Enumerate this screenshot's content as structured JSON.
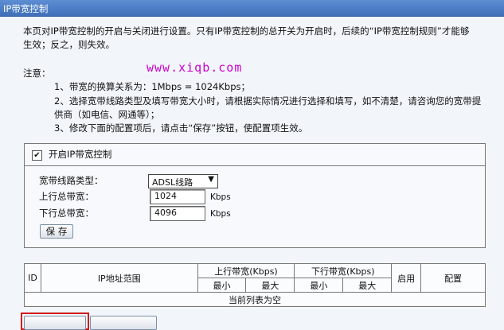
{
  "window": {
    "title": "IP带宽控制"
  },
  "intro": {
    "line1": "本页对IP带宽控制的开启与关闭进行设置。只有IP带宽控制的总开关为开启时，后续的“IP带宽控制规则”才能够",
    "line2": "生效；反之，则失效。"
  },
  "watermark": "www.xiqb.com",
  "notes": {
    "label": "注意：",
    "n1": "1、带宽的换算关系为：1Mbps = 1024Kbps；",
    "n2a": "2、选择宽带线路类型及填写带宽大小时，请根据实际情况进行选择和填写，如不清楚，请咨询您的宽带提",
    "n2b": "供商（如电信、网通等）；",
    "n3": "3、修改下面的配置项后，请点击“保存”按钮，使配置项生效。"
  },
  "enable": {
    "label": "开启IP带宽控制",
    "checked_mark": "✔"
  },
  "form": {
    "line_type_label": "宽带线路类型：",
    "line_type_value": "ADSL线路",
    "upload_label": "上行总带宽：",
    "upload_value": "1024",
    "download_label": "下行总带宽：",
    "download_value": "4096",
    "unit": "Kbps",
    "save_label": "保 存"
  },
  "table": {
    "col_id": "ID",
    "col_range": "IP地址范围",
    "col_up": "上行带宽(Kbps)",
    "col_down": "下行带宽(Kbps)",
    "col_enable": "启用",
    "col_config": "配置",
    "min": "最小",
    "max": "最大",
    "empty": "当前列表为空"
  }
}
